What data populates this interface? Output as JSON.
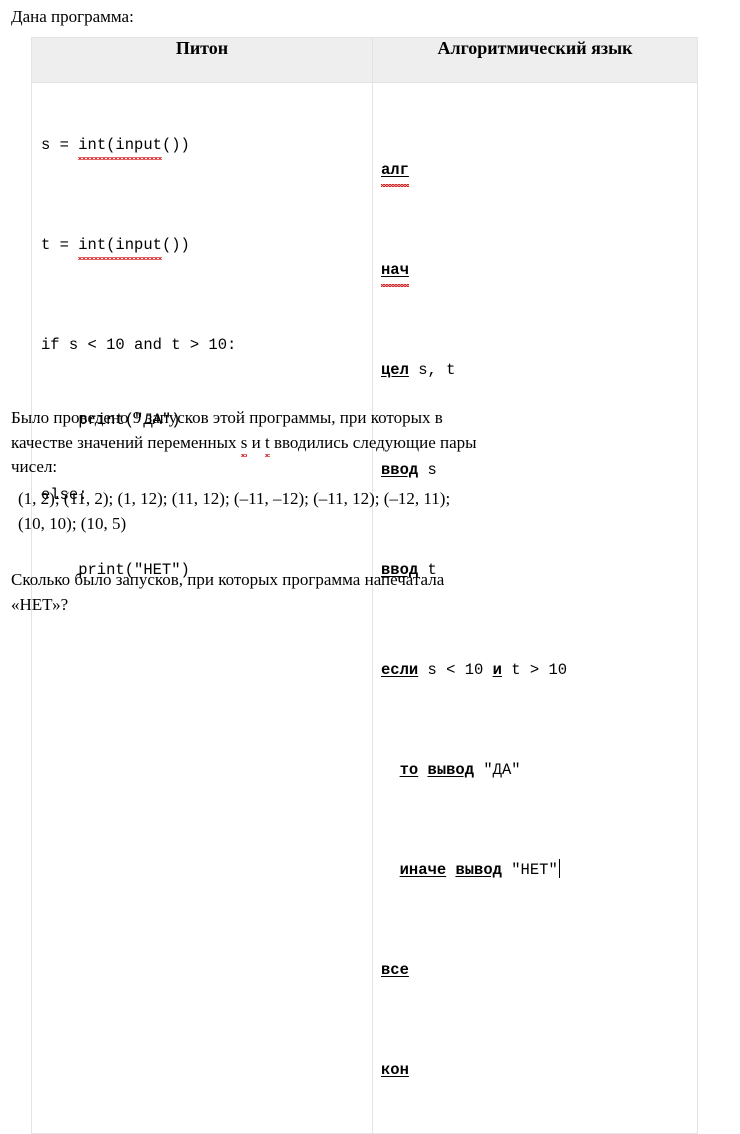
{
  "document": {
    "intro": "Дана программа:",
    "table": {
      "headers": {
        "left": "Питон",
        "right": "Алгоритмический язык"
      },
      "python_code": [
        "s = int(input())",
        "t = int(input())",
        "if s < 10 and t > 10:",
        "    print(\"ДА\")",
        "else:",
        "    print(\"НЕТ\")"
      ],
      "python_code_parts": {
        "l1_a": "s = ",
        "l1_b": "int(input",
        "l1_c": "())",
        "l2_a": "t = ",
        "l2_b": "int(input",
        "l2_c": "())",
        "l3": "if s < 10 and t > 10:",
        "l4": "    print(\"ДА\")",
        "l5": "else:",
        "l6": "    print(\"НЕТ\")"
      },
      "algo_code": [
        "алг",
        "нач",
        "цел s, t",
        "ввод s",
        "ввод t",
        "если s < 10 и t > 10",
        "  то вывод \"ДА\"",
        "  иначе вывод \"НЕТ\"",
        "все",
        "кон"
      ],
      "algo_code_parts": {
        "kw_alg": "алг",
        "kw_nach": "нач",
        "kw_cel": "цел",
        "cel_rest": " s, t",
        "kw_vvod1": "ввод",
        "vvod1_rest": " s",
        "kw_vvod2": "ввод",
        "vvod2_rest": " t",
        "kw_esli": "если",
        "esli_mid": " s < 10 ",
        "kw_i": "и",
        "esli_rest": " t > 10",
        "kw_to": "то",
        "kw_vyvod1": "вывод",
        "to_rest": " \"ДА\"",
        "kw_inache": "иначе",
        "kw_vyvod2": "вывод",
        "inache_rest": " \"НЕТ\"",
        "kw_vse": "все",
        "kw_kon": "кон"
      }
    },
    "paragraph_runs": {
      "line1": "Было проведено 9 запусков этой программы, при которых в",
      "line2_a": "качестве значений переменных ",
      "line2_var1": "s",
      "line2_b": " и ",
      "line2_var2": "t",
      "line2_c": " вводились следующие пары",
      "line3": "чисел:"
    },
    "paragraph_pairs": {
      "line1": "(1, 2); (11, 2); (1, 12); (11, 12); (–11, –12);   (–11, 12); (–12, 11);",
      "line2": "(10, 10); (10, 5)"
    },
    "paragraph_question": {
      "line1": "Сколько было запусков, при которых программа напечатала",
      "line2": "«НЕТ»?"
    },
    "colors": {
      "header_background": "#eeeeee",
      "table_border": "#e3e3e3",
      "spellcheck_underline": "#d22b2b",
      "text": "#000000",
      "page_background": "#ffffff"
    }
  }
}
